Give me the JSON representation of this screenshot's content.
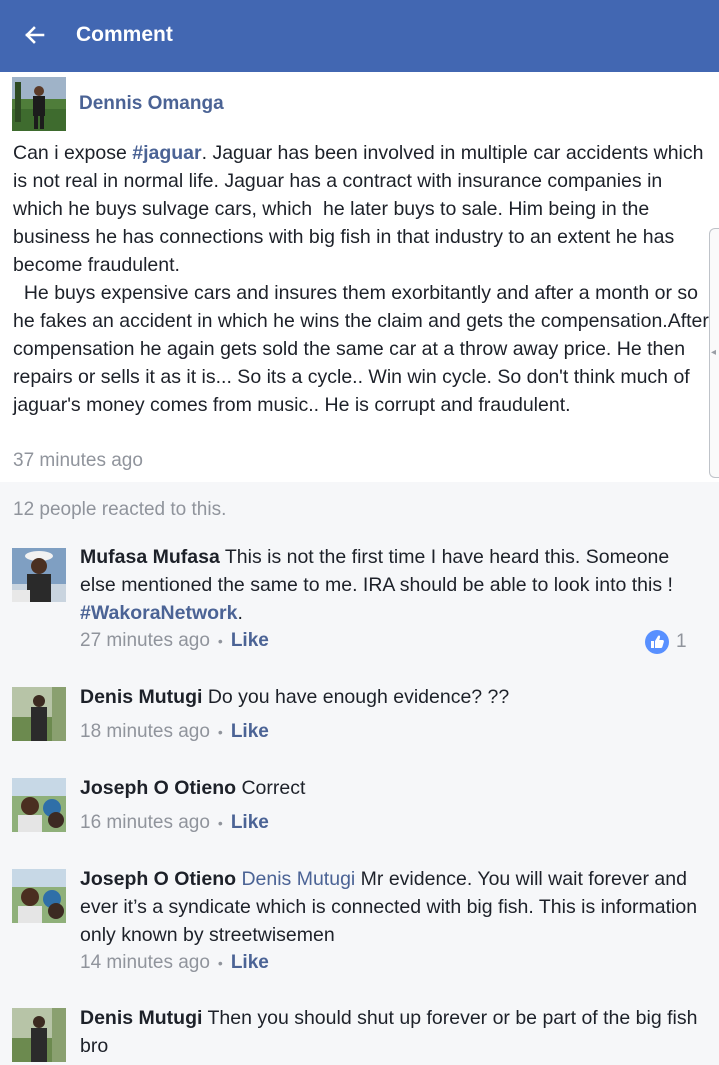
{
  "header": {
    "back_icon": "arrow-left-icon",
    "title": "Comment",
    "bar_color": "#4267b2"
  },
  "post": {
    "author": "Dennis Omanga",
    "body_prefix": "Can i expose ",
    "hashtag": "#jaguar",
    "body_rest": ". Jaguar has been involved in multiple car accidents which is not real in normal life. Jaguar has a contract with insurance companies in which he buys sulvage cars, which  he later buys to sale. Him being in the business he has connections with big fish in that industry to an extent he has become fraudulent.\n  He buys expensive cars and insures them exorbitantly and after a month or so he fakes an accident in which he wins the claim and gets the compensation.After compensation he again gets sold the same car at a throw away price. He then repairs or sells it as it is... So its a cycle.. Win win cycle. So don't think much of jaguar's money comes from music.. He is corrupt and fraudulent.",
    "time": "37 minutes ago"
  },
  "reactions_summary": "12 people reacted to this.",
  "comments": [
    {
      "name": "Mufasa Mufasa",
      "text_a": " This is not the first time I have heard this. Someone else mentioned the same to me. IRA should be able to look into this ! ",
      "hashtag": "#WakoraNetwork",
      "text_b": ".",
      "time": "27 minutes ago",
      "dot": "•",
      "like": "Like",
      "like_icon": "thumbs-up-icon",
      "like_count": "1"
    },
    {
      "name": "Denis Mutugi",
      "text": " Do you have enough evidence? ??",
      "time": "18 minutes ago",
      "dot": "•",
      "like": "Like"
    },
    {
      "name": "Joseph O Otieno",
      "text": " Correct",
      "time": "16 minutes ago",
      "dot": "•",
      "like": "Like"
    },
    {
      "name": "Joseph O Otieno",
      "mention": " Denis Mutugi",
      "text": "  Mr evidence. You will wait forever and ever it’s a syndicate which is connected with big fish. This is information only known by streetwisemen",
      "time": "14 minutes ago",
      "dot": "•",
      "like": "Like"
    },
    {
      "name": "Denis Mutugi",
      "text": " Then you should shut up forever or be part of the big fish bro"
    }
  ],
  "colors": {
    "link": "#4b6395",
    "meta": "#90949c",
    "comments_bg": "#f6f7f9",
    "like_badge": "#5890ff"
  }
}
